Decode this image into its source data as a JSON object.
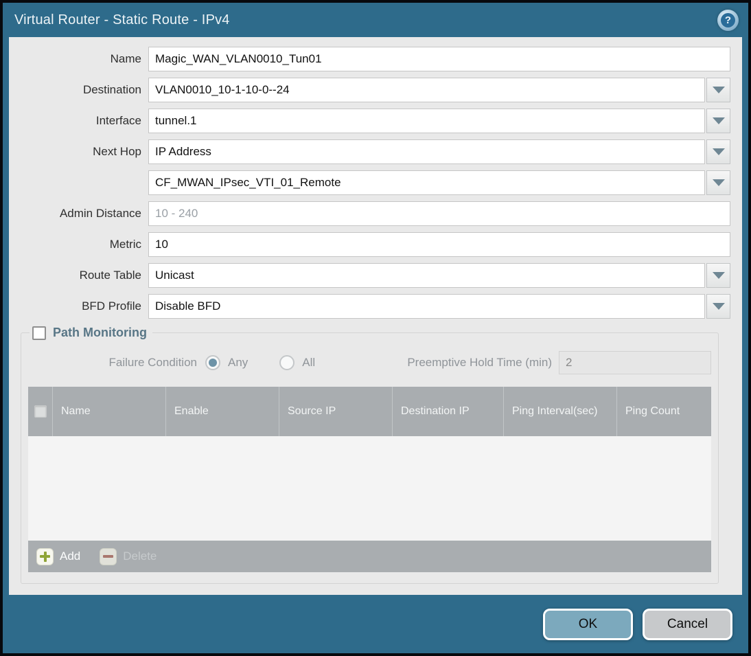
{
  "dialog": {
    "title": "Virtual Router - Static Route - IPv4",
    "help_glyph": "?"
  },
  "form": {
    "name": {
      "label": "Name",
      "value": "Magic_WAN_VLAN0010_Tun01"
    },
    "destination": {
      "label": "Destination",
      "value": "VLAN0010_10-1-10-0--24"
    },
    "interface": {
      "label": "Interface",
      "value": "tunnel.1"
    },
    "next_hop": {
      "label": "Next Hop",
      "value": "IP Address"
    },
    "next_hop_address": {
      "value": "CF_MWAN_IPsec_VTI_01_Remote"
    },
    "admin_distance": {
      "label": "Admin Distance",
      "placeholder": "10 - 240"
    },
    "metric": {
      "label": "Metric",
      "value": "10"
    },
    "route_table": {
      "label": "Route Table",
      "value": "Unicast"
    },
    "bfd_profile": {
      "label": "BFD Profile",
      "value": "Disable BFD"
    }
  },
  "path_monitoring": {
    "title": "Path Monitoring",
    "enabled": false,
    "failure_condition": {
      "label": "Failure Condition",
      "options": [
        "Any",
        "All"
      ],
      "selected": "Any"
    },
    "preemptive_hold_time": {
      "label": "Preemptive Hold Time (min)",
      "value": "2"
    },
    "table": {
      "columns": [
        "Name",
        "Enable",
        "Source IP",
        "Destination IP",
        "Ping Interval(sec)",
        "Ping Count"
      ],
      "rows": []
    },
    "toolbar": {
      "add_label": "Add",
      "delete_label": "Delete"
    }
  },
  "footer": {
    "ok_label": "OK",
    "cancel_label": "Cancel"
  },
  "colors": {
    "titlebar_teal": "#2e6b8b",
    "panel_gray": "#e9e9e9",
    "table_header_gray": "#a9adb0",
    "ok_button": "#7ca9bd",
    "cancel_button": "#c7c9cb",
    "add_icon_green": "#8fa437",
    "delete_icon_red": "#aa6a5e",
    "radio_selected": "#6e94a8"
  }
}
